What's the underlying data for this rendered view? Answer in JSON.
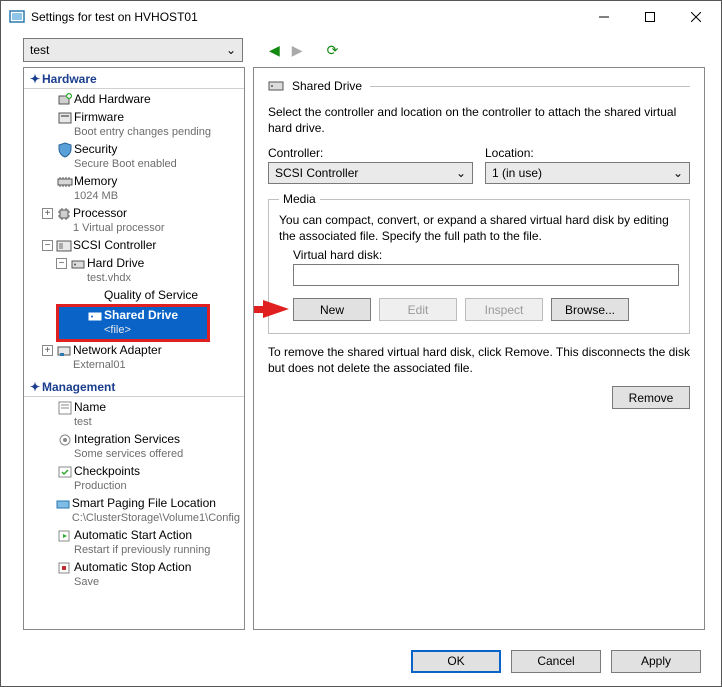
{
  "window": {
    "title": "Settings for test on HVHOST01"
  },
  "toolbar": {
    "vm_name": "test"
  },
  "tree": {
    "hardware": {
      "header": "Hardware",
      "add_hardware": "Add Hardware",
      "firmware": "Firmware",
      "firmware_sub": "Boot entry changes pending",
      "security": "Security",
      "security_sub": "Secure Boot enabled",
      "memory": "Memory",
      "memory_sub": "1024 MB",
      "processor": "Processor",
      "processor_sub": "1 Virtual processor",
      "scsi": "SCSI Controller",
      "hard_drive": "Hard Drive",
      "hard_drive_sub": "test.vhdx",
      "qos": "Quality of Service",
      "shared_drive": "Shared Drive",
      "shared_drive_sub": "<file>",
      "net": "Network Adapter",
      "net_sub": "External01"
    },
    "management": {
      "header": "Management",
      "name": "Name",
      "name_sub": "test",
      "integ": "Integration Services",
      "integ_sub": "Some services offered",
      "chk": "Checkpoints",
      "chk_sub": "Production",
      "paging": "Smart Paging File Location",
      "paging_sub": "C:\\ClusterStorage\\Volume1\\Config",
      "start": "Automatic Start Action",
      "start_sub": "Restart if previously running",
      "stop": "Automatic Stop Action",
      "stop_sub": "Save"
    }
  },
  "content": {
    "heading": "Shared Drive",
    "desc": "Select the controller and location on the controller to attach the shared virtual hard drive.",
    "controller_lbl": "Controller:",
    "controller_val": "SCSI Controller",
    "location_lbl": "Location:",
    "location_val": "1 (in use)",
    "media_legend": "Media",
    "media_desc": "You can compact, convert, or expand a shared virtual hard disk by editing the associated file. Specify the full path to the file.",
    "vhd_lbl": "Virtual hard disk:",
    "vhd_val": "",
    "btn_new": "New",
    "btn_edit": "Edit",
    "btn_inspect": "Inspect",
    "btn_browse": "Browse...",
    "remove_desc": "To remove the shared virtual hard disk, click Remove. This disconnects the disk but does not delete the associated file.",
    "btn_remove": "Remove"
  },
  "footer": {
    "ok": "OK",
    "cancel": "Cancel",
    "apply": "Apply"
  }
}
